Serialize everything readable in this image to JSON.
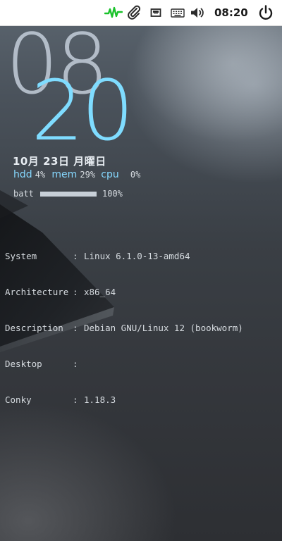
{
  "panel": {
    "clock": "08:20",
    "tray_icons": [
      "system-monitor-icon",
      "paperclip-icon",
      "network-icon",
      "keyboard-icon",
      "volume-icon",
      "power-icon"
    ],
    "colors": {
      "background": "#ffffff",
      "monitor_green": "#19c22a",
      "icon_dark": "#2a2a2a"
    }
  },
  "conky": {
    "hour": "08",
    "minute": "20",
    "date": "10月 23日 月曜日",
    "hdd_label": "hdd",
    "hdd_value": "4%",
    "mem_label": "mem",
    "mem_value": "29%",
    "cpu_label": "cpu",
    "cpu_value": "0%",
    "batt_label": "batt",
    "batt_value": "100%",
    "batt_fraction": 1.0,
    "colors": {
      "accent": "#86d8ff",
      "minute": "#7fdcff",
      "hour": "#c8d2de",
      "text": "#d6dbe0"
    },
    "sysinfo": [
      {
        "key": "System",
        "sep": ":",
        "value": "Linux 6.1.0-13-amd64"
      },
      {
        "key": "Architecture",
        "sep": ":",
        "value": "x86_64"
      },
      {
        "key": "Description",
        "sep": ":",
        "value": "Debian GNU/Linux 12 (bookworm)"
      },
      {
        "key": "Desktop",
        "sep": ":",
        "value": ""
      },
      {
        "key": "Conky",
        "sep": ":",
        "value": "1.18.3"
      }
    ]
  }
}
